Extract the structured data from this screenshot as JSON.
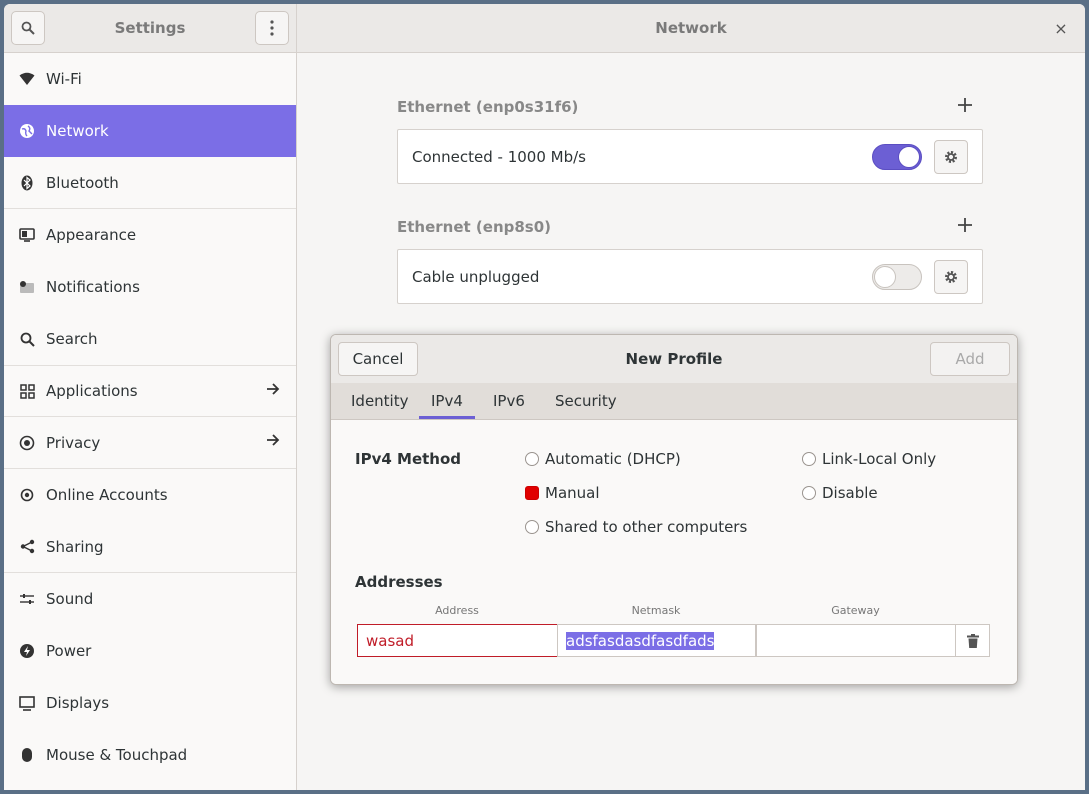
{
  "header": {
    "sidebar_title": "Settings",
    "main_title": "Network",
    "close_glyph": "×"
  },
  "sidebar": {
    "items": [
      {
        "label": "Wi-Fi",
        "icon": "wifi-icon"
      },
      {
        "label": "Network",
        "icon": "network-icon",
        "active": true
      },
      {
        "label": "Bluetooth",
        "icon": "bluetooth-icon"
      },
      {
        "label": "Appearance",
        "icon": "appearance-icon"
      },
      {
        "label": "Notifications",
        "icon": "notifications-icon"
      },
      {
        "label": "Search",
        "icon": "search-icon"
      },
      {
        "label": "Applications",
        "icon": "applications-icon",
        "arrow": true
      },
      {
        "label": "Privacy",
        "icon": "privacy-icon",
        "arrow": true
      },
      {
        "label": "Online Accounts",
        "icon": "online-accounts-icon"
      },
      {
        "label": "Sharing",
        "icon": "sharing-icon"
      },
      {
        "label": "Sound",
        "icon": "sound-icon"
      },
      {
        "label": "Power",
        "icon": "power-icon"
      },
      {
        "label": "Displays",
        "icon": "displays-icon"
      },
      {
        "label": "Mouse & Touchpad",
        "icon": "mouse-icon"
      }
    ]
  },
  "ethernet": [
    {
      "title": "Ethernet (enp0s31f6)",
      "status": "Connected - 1000 Mb/s",
      "enabled": true
    },
    {
      "title": "Ethernet (enp8s0)",
      "status": "Cable unplugged",
      "enabled": false
    }
  ],
  "dialog": {
    "cancel_label": "Cancel",
    "title": "New Profile",
    "add_label": "Add",
    "tabs": [
      "Identity",
      "IPv4",
      "IPv6",
      "Security"
    ],
    "active_tab": "IPv4",
    "method_label": "IPv4 Method",
    "methods": {
      "automatic": "Automatic (DHCP)",
      "manual": "Manual",
      "shared": "Shared to other computers",
      "link_local": "Link-Local Only",
      "disable": "Disable"
    },
    "selected_method": "Manual",
    "addresses_label": "Addresses",
    "columns": {
      "address": "Address",
      "netmask": "Netmask",
      "gateway": "Gateway"
    },
    "row": {
      "address": "wasad",
      "netmask": "adsfasdasdfasdfads",
      "gateway": ""
    }
  },
  "colors": {
    "accent": "#7b6ee6",
    "error": "#c01c28",
    "radio_checked": "#e00000"
  }
}
